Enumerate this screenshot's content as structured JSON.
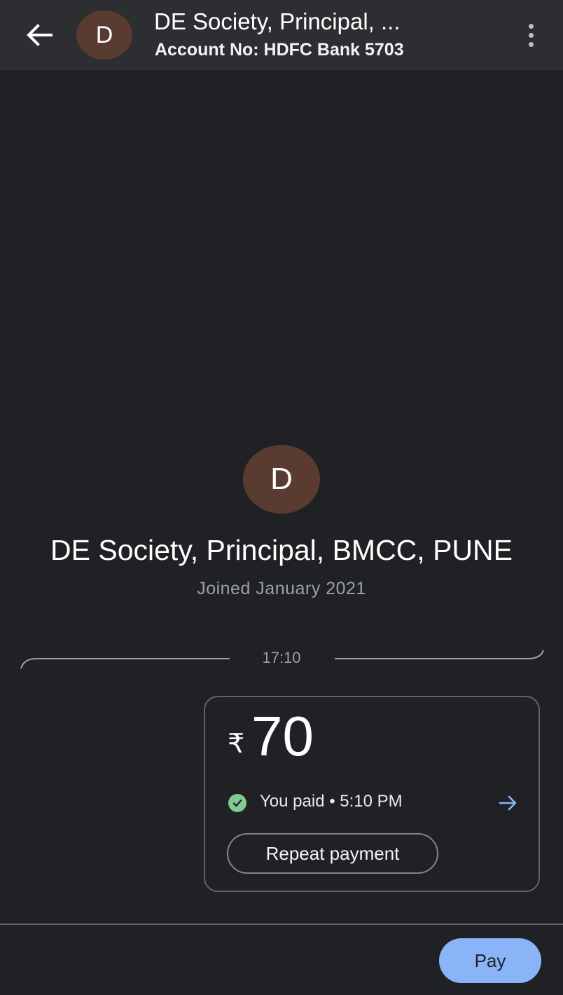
{
  "header": {
    "avatar_initial": "D",
    "title": "DE Society, Principal, ...",
    "subtitle": "Account No: HDFC Bank 5703"
  },
  "profile": {
    "avatar_initial": "D",
    "name": "DE Society, Principal, BMCC, PUNE",
    "joined": "Joined January 2021"
  },
  "timeline": {
    "time": "17:10"
  },
  "payment": {
    "currency_symbol": "₹",
    "amount": "70",
    "status": "You paid • 5:10 PM",
    "repeat_label": "Repeat payment"
  },
  "footer": {
    "pay_label": "Pay"
  },
  "colors": {
    "background": "#202124",
    "avatar": "#5a3b31",
    "success": "#81c995",
    "accent": "#8ab4f8"
  }
}
